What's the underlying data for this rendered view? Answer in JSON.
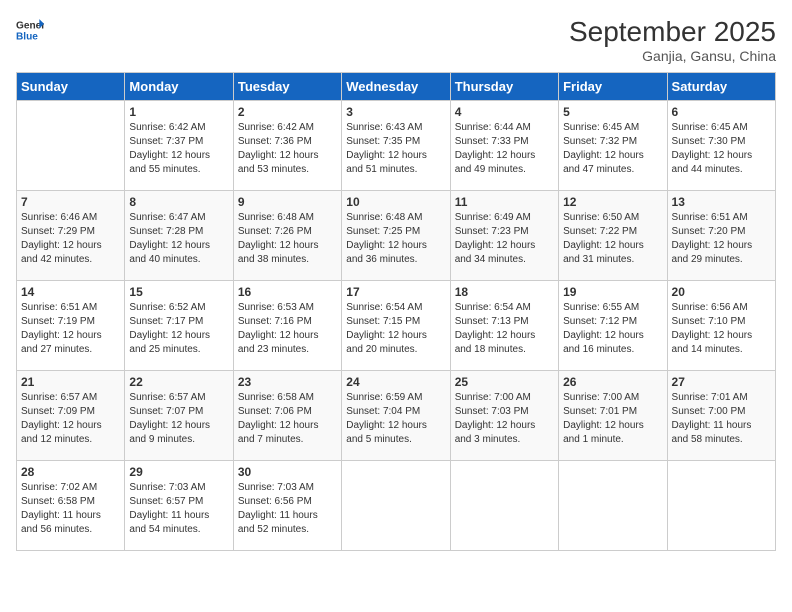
{
  "header": {
    "logo_general": "General",
    "logo_blue": "Blue",
    "month_title": "September 2025",
    "location": "Ganjia, Gansu, China"
  },
  "days_of_week": [
    "Sunday",
    "Monday",
    "Tuesday",
    "Wednesday",
    "Thursday",
    "Friday",
    "Saturday"
  ],
  "weeks": [
    [
      {
        "num": "",
        "info": ""
      },
      {
        "num": "1",
        "info": "Sunrise: 6:42 AM\nSunset: 7:37 PM\nDaylight: 12 hours\nand 55 minutes."
      },
      {
        "num": "2",
        "info": "Sunrise: 6:42 AM\nSunset: 7:36 PM\nDaylight: 12 hours\nand 53 minutes."
      },
      {
        "num": "3",
        "info": "Sunrise: 6:43 AM\nSunset: 7:35 PM\nDaylight: 12 hours\nand 51 minutes."
      },
      {
        "num": "4",
        "info": "Sunrise: 6:44 AM\nSunset: 7:33 PM\nDaylight: 12 hours\nand 49 minutes."
      },
      {
        "num": "5",
        "info": "Sunrise: 6:45 AM\nSunset: 7:32 PM\nDaylight: 12 hours\nand 47 minutes."
      },
      {
        "num": "6",
        "info": "Sunrise: 6:45 AM\nSunset: 7:30 PM\nDaylight: 12 hours\nand 44 minutes."
      }
    ],
    [
      {
        "num": "7",
        "info": "Sunrise: 6:46 AM\nSunset: 7:29 PM\nDaylight: 12 hours\nand 42 minutes."
      },
      {
        "num": "8",
        "info": "Sunrise: 6:47 AM\nSunset: 7:28 PM\nDaylight: 12 hours\nand 40 minutes."
      },
      {
        "num": "9",
        "info": "Sunrise: 6:48 AM\nSunset: 7:26 PM\nDaylight: 12 hours\nand 38 minutes."
      },
      {
        "num": "10",
        "info": "Sunrise: 6:48 AM\nSunset: 7:25 PM\nDaylight: 12 hours\nand 36 minutes."
      },
      {
        "num": "11",
        "info": "Sunrise: 6:49 AM\nSunset: 7:23 PM\nDaylight: 12 hours\nand 34 minutes."
      },
      {
        "num": "12",
        "info": "Sunrise: 6:50 AM\nSunset: 7:22 PM\nDaylight: 12 hours\nand 31 minutes."
      },
      {
        "num": "13",
        "info": "Sunrise: 6:51 AM\nSunset: 7:20 PM\nDaylight: 12 hours\nand 29 minutes."
      }
    ],
    [
      {
        "num": "14",
        "info": "Sunrise: 6:51 AM\nSunset: 7:19 PM\nDaylight: 12 hours\nand 27 minutes."
      },
      {
        "num": "15",
        "info": "Sunrise: 6:52 AM\nSunset: 7:17 PM\nDaylight: 12 hours\nand 25 minutes."
      },
      {
        "num": "16",
        "info": "Sunrise: 6:53 AM\nSunset: 7:16 PM\nDaylight: 12 hours\nand 23 minutes."
      },
      {
        "num": "17",
        "info": "Sunrise: 6:54 AM\nSunset: 7:15 PM\nDaylight: 12 hours\nand 20 minutes."
      },
      {
        "num": "18",
        "info": "Sunrise: 6:54 AM\nSunset: 7:13 PM\nDaylight: 12 hours\nand 18 minutes."
      },
      {
        "num": "19",
        "info": "Sunrise: 6:55 AM\nSunset: 7:12 PM\nDaylight: 12 hours\nand 16 minutes."
      },
      {
        "num": "20",
        "info": "Sunrise: 6:56 AM\nSunset: 7:10 PM\nDaylight: 12 hours\nand 14 minutes."
      }
    ],
    [
      {
        "num": "21",
        "info": "Sunrise: 6:57 AM\nSunset: 7:09 PM\nDaylight: 12 hours\nand 12 minutes."
      },
      {
        "num": "22",
        "info": "Sunrise: 6:57 AM\nSunset: 7:07 PM\nDaylight: 12 hours\nand 9 minutes."
      },
      {
        "num": "23",
        "info": "Sunrise: 6:58 AM\nSunset: 7:06 PM\nDaylight: 12 hours\nand 7 minutes."
      },
      {
        "num": "24",
        "info": "Sunrise: 6:59 AM\nSunset: 7:04 PM\nDaylight: 12 hours\nand 5 minutes."
      },
      {
        "num": "25",
        "info": "Sunrise: 7:00 AM\nSunset: 7:03 PM\nDaylight: 12 hours\nand 3 minutes."
      },
      {
        "num": "26",
        "info": "Sunrise: 7:00 AM\nSunset: 7:01 PM\nDaylight: 12 hours\nand 1 minute."
      },
      {
        "num": "27",
        "info": "Sunrise: 7:01 AM\nSunset: 7:00 PM\nDaylight: 11 hours\nand 58 minutes."
      }
    ],
    [
      {
        "num": "28",
        "info": "Sunrise: 7:02 AM\nSunset: 6:58 PM\nDaylight: 11 hours\nand 56 minutes."
      },
      {
        "num": "29",
        "info": "Sunrise: 7:03 AM\nSunset: 6:57 PM\nDaylight: 11 hours\nand 54 minutes."
      },
      {
        "num": "30",
        "info": "Sunrise: 7:03 AM\nSunset: 6:56 PM\nDaylight: 11 hours\nand 52 minutes."
      },
      {
        "num": "",
        "info": ""
      },
      {
        "num": "",
        "info": ""
      },
      {
        "num": "",
        "info": ""
      },
      {
        "num": "",
        "info": ""
      }
    ]
  ]
}
